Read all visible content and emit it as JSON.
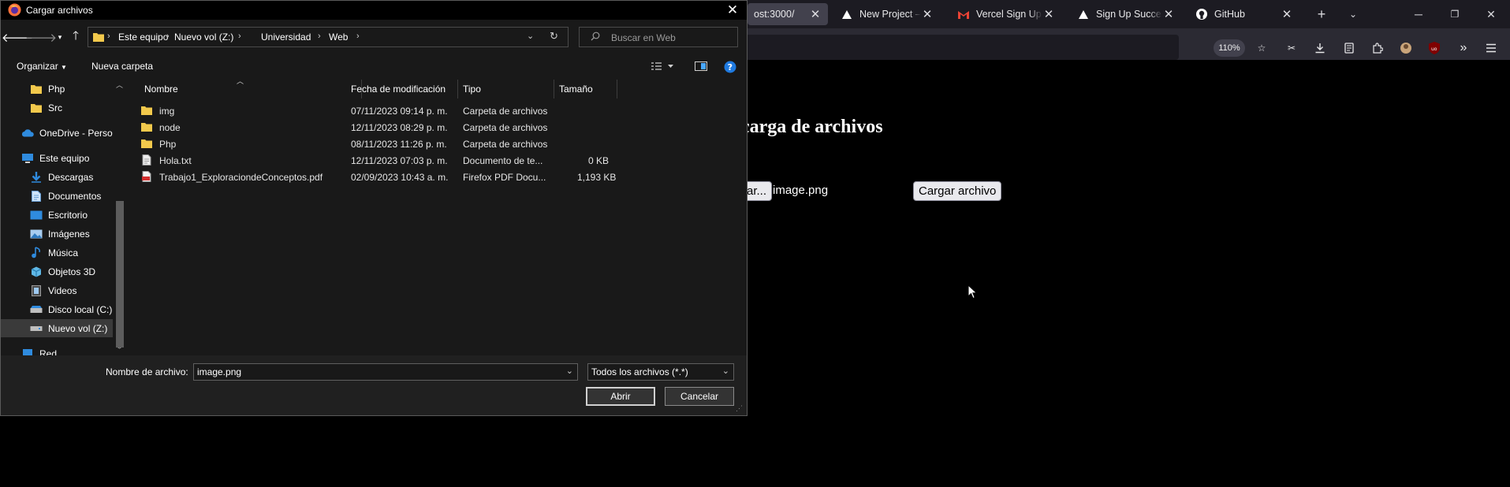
{
  "browser": {
    "tabs": [
      {
        "title": "ost:3000/",
        "icon": "localhost-icon",
        "active": true
      },
      {
        "title": "New Project – Ver",
        "icon": "vercel-icon"
      },
      {
        "title": "Vercel Sign Up Ve",
        "icon": "gmail-icon"
      },
      {
        "title": "Sign Up Successfu",
        "icon": "vercel-icon"
      },
      {
        "title": "GitHub",
        "icon": "github-icon"
      }
    ],
    "zoom": "110%",
    "colors": {
      "tabstrip": "#1c1b22",
      "toolbar": "#2b2a33",
      "active_tab": "#42414d"
    }
  },
  "page": {
    "heading": "carga de archivos",
    "browse_button_label": "ar...",
    "selected_file": "image.png",
    "upload_button_label": "Cargar archivo"
  },
  "dialog": {
    "title": "Cargar archivos",
    "breadcrumb": [
      "Este equipo",
      "Nuevo vol (Z:)",
      "Universidad",
      "Web"
    ],
    "search_placeholder": "Buscar en Web",
    "commands": {
      "organize": "Organizar",
      "new_folder": "Nueva carpeta"
    },
    "nav_items": [
      {
        "label": "Php",
        "icon": "folder-icon"
      },
      {
        "label": "Src",
        "icon": "folder-icon"
      },
      {
        "label": "OneDrive - Persor",
        "icon": "cloud-icon"
      },
      {
        "label": "Este equipo",
        "icon": "computer-icon"
      },
      {
        "label": "Descargas",
        "icon": "download-icon"
      },
      {
        "label": "Documentos",
        "icon": "document-icon"
      },
      {
        "label": "Escritorio",
        "icon": "desktop-icon"
      },
      {
        "label": "Imágenes",
        "icon": "image-icon"
      },
      {
        "label": "Música",
        "icon": "music-icon"
      },
      {
        "label": "Objetos 3D",
        "icon": "cube-icon"
      },
      {
        "label": "Videos",
        "icon": "video-icon"
      },
      {
        "label": "Disco local (C:)",
        "icon": "drive-icon"
      },
      {
        "label": "Nuevo vol (Z:)",
        "icon": "drive-icon",
        "selected": true
      },
      {
        "label": "Red",
        "icon": "network-icon"
      }
    ],
    "columns": [
      "Nombre",
      "Fecha de modificación",
      "Tipo",
      "Tamaño"
    ],
    "files": [
      {
        "name": "img",
        "date": "07/11/2023 09:14 p. m.",
        "type": "Carpeta de archivos",
        "size": "",
        "icon": "folder-icon"
      },
      {
        "name": "node",
        "date": "12/11/2023 08:29 p. m.",
        "type": "Carpeta de archivos",
        "size": "",
        "icon": "folder-icon"
      },
      {
        "name": "Php",
        "date": "08/11/2023 11:26 p. m.",
        "type": "Carpeta de archivos",
        "size": "",
        "icon": "folder-icon"
      },
      {
        "name": "Hola.txt",
        "date": "12/11/2023 07:03 p. m.",
        "type": "Documento de te...",
        "size": "0 KB",
        "icon": "text-file-icon"
      },
      {
        "name": "Trabajo1_ExploraciondeConceptos.pdf",
        "date": "02/09/2023 10:43 a. m.",
        "type": "Firefox PDF Docu...",
        "size": "1,193 KB",
        "icon": "pdf-file-icon"
      }
    ],
    "filename_label": "Nombre de archivo:",
    "filename_value": "image.png",
    "filetype_value": "Todos los archivos (*.*)",
    "open_label": "Abrir",
    "cancel_label": "Cancelar"
  }
}
